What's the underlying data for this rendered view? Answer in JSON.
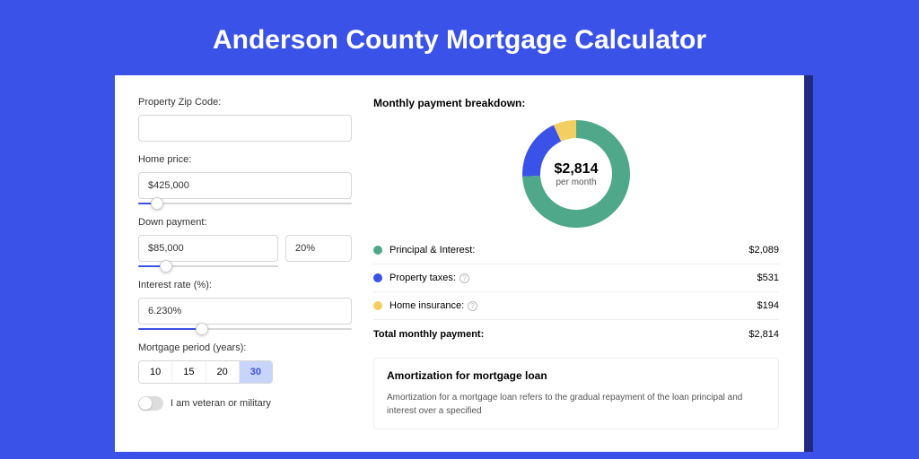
{
  "title": "Anderson County Mortgage Calculator",
  "form": {
    "zip_label": "Property Zip Code:",
    "zip_value": "",
    "home_price_label": "Home price:",
    "home_price_value": "$425,000",
    "home_price_slider_pct": 9,
    "down_payment_label": "Down payment:",
    "down_payment_value": "$85,000",
    "down_payment_pct_value": "20%",
    "down_payment_slider_pct": 20,
    "interest_label": "Interest rate (%):",
    "interest_value": "6.230%",
    "interest_slider_pct": 30,
    "period_label": "Mortgage period (years):",
    "periods": [
      "10",
      "15",
      "20",
      "30"
    ],
    "period_active": "30",
    "veteran_label": "I am veteran or military"
  },
  "breakdown": {
    "heading": "Monthly payment breakdown:",
    "center_amount": "$2,814",
    "center_sub": "per month",
    "items": [
      {
        "label": "Principal & Interest:",
        "value": "$2,089",
        "color": "#4fa88a",
        "info": false
      },
      {
        "label": "Property taxes:",
        "value": "$531",
        "color": "#3a52e8",
        "info": true
      },
      {
        "label": "Home insurance:",
        "value": "$194",
        "color": "#f3cf62",
        "info": true
      }
    ],
    "total_label": "Total monthly payment:",
    "total_value": "$2,814"
  },
  "chart_data": {
    "type": "pie",
    "title": "Monthly payment breakdown",
    "series": [
      {
        "name": "Principal & Interest",
        "value": 2089,
        "color": "#4fa88a"
      },
      {
        "name": "Property taxes",
        "value": 531,
        "color": "#3a52e8"
      },
      {
        "name": "Home insurance",
        "value": 194,
        "color": "#f3cf62"
      }
    ],
    "center_label": "$2,814 per month"
  },
  "amort": {
    "title": "Amortization for mortgage loan",
    "body": "Amortization for a mortgage loan refers to the gradual repayment of the loan principal and interest over a specified"
  }
}
